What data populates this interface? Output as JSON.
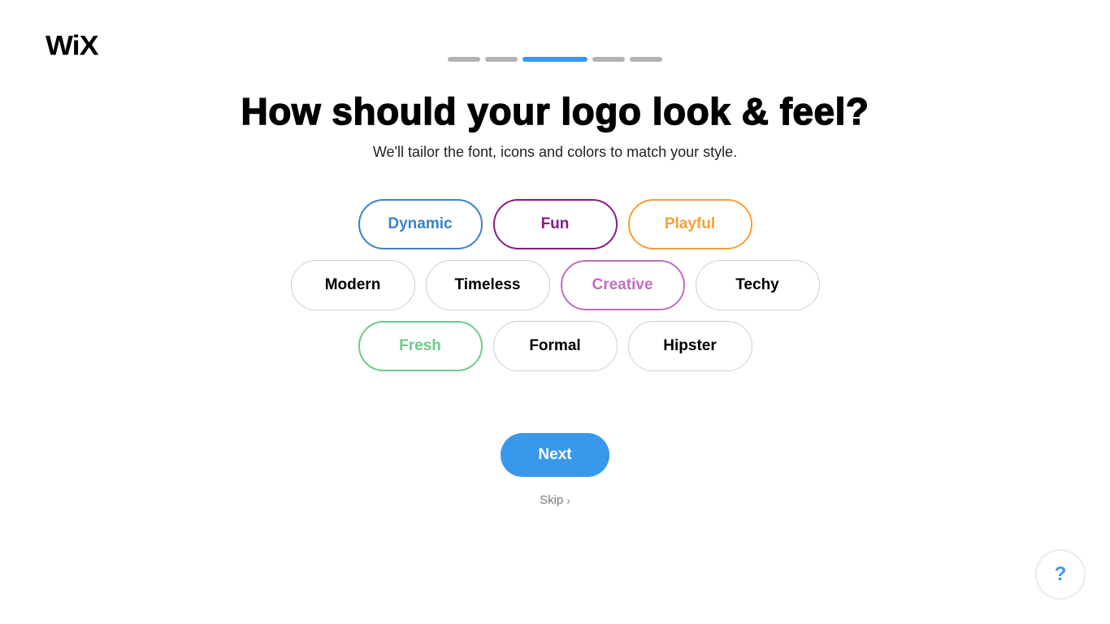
{
  "brand": {
    "logo_text": "WiX"
  },
  "progress": {
    "total_steps": 5,
    "current_step": 3
  },
  "header": {
    "title": "How should your logo look & feel?",
    "subtitle": "We'll tailor the font, icons and colors to match your style."
  },
  "options": {
    "rows": [
      [
        {
          "label": "Dynamic",
          "selected": true,
          "color": "#3a82c8"
        },
        {
          "label": "Fun",
          "selected": true,
          "color": "#8a1a7e"
        },
        {
          "label": "Playful",
          "selected": true,
          "color": "#f5a034"
        }
      ],
      [
        {
          "label": "Modern",
          "selected": false,
          "color": "#000000"
        },
        {
          "label": "Timeless",
          "selected": false,
          "color": "#000000"
        },
        {
          "label": "Creative",
          "selected": true,
          "color": "#c26cc0"
        },
        {
          "label": "Techy",
          "selected": false,
          "color": "#000000"
        }
      ],
      [
        {
          "label": "Fresh",
          "selected": true,
          "color": "#6ccb8b"
        },
        {
          "label": "Formal",
          "selected": false,
          "color": "#000000"
        },
        {
          "label": "Hipster",
          "selected": false,
          "color": "#000000"
        }
      ]
    ]
  },
  "actions": {
    "next_label": "Next",
    "skip_label": "Skip",
    "skip_icon": "chevron-right-icon",
    "help_label": "?"
  },
  "colors": {
    "accent": "#3899ec",
    "inactive_progress": "#b3b3b3",
    "pill_border_default": "#cfcfcf"
  }
}
